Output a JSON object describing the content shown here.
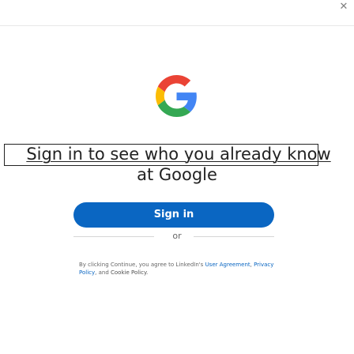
{
  "window": {
    "close_glyph": "✕",
    "topbar_color": "#ffffff"
  },
  "logo": {
    "name": "google-g-logo",
    "colors": {
      "blue": "#4285F4",
      "green": "#34A853",
      "yellow": "#FBBC05",
      "red": "#EA4335"
    }
  },
  "headline": {
    "line1": "Sign in to see who you already know",
    "line2": "at Google"
  },
  "signin_button": {
    "label": "Sign in",
    "color": "#0a66c2"
  },
  "separator": {
    "label": "or"
  },
  "legal": {
    "prefix": "By clicking Continue, you agree to LinkedIn's ",
    "user_agreement": "User Agreement",
    "comma1": ", ",
    "privacy_policy": "Privacy Policy",
    "and": ", and ",
    "cookie_policy": "Cookie Policy",
    "suffix": "."
  }
}
